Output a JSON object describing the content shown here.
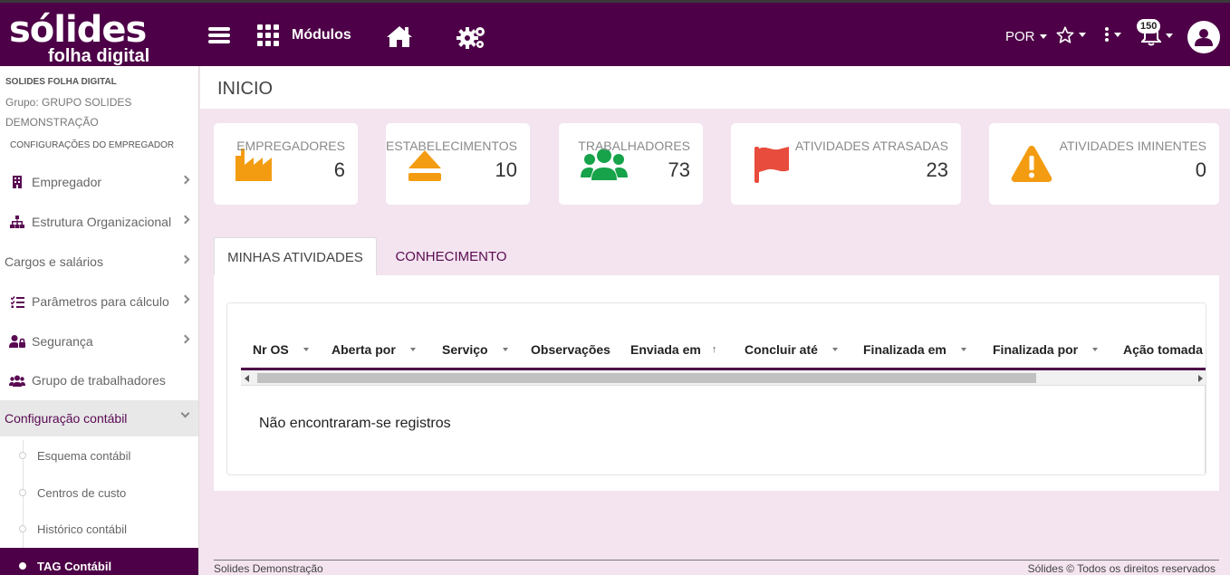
{
  "topbar": {
    "logo_line1": "sólides",
    "logo_line2": "folha digital",
    "modules_label": "Módulos",
    "language": "POR",
    "notifications_count": "150"
  },
  "sidebar": {
    "company": "SOLIDES FOLHA DIGITAL",
    "group": "Grupo: GRUPO SOLIDES DEMONSTRAÇÃO",
    "section": "CONFIGURAÇÕES DO EMPREGADOR",
    "items": [
      {
        "label": "Empregador",
        "icon": "building-icon"
      },
      {
        "label": "Estrutura Organizacional",
        "icon": "sitemap-icon"
      },
      {
        "label": "Cargos e salários",
        "icon": ""
      },
      {
        "label": "Parâmetros para cálculo",
        "icon": "list-check-icon"
      },
      {
        "label": "Segurança",
        "icon": "user-lock-icon"
      },
      {
        "label": "Grupo de trabalhadores",
        "icon": "users-icon"
      },
      {
        "label": "Configuração contábil",
        "icon": ""
      }
    ],
    "subitems": [
      {
        "label": "Esquema contábil"
      },
      {
        "label": "Centros de custo"
      },
      {
        "label": "Histórico contábil"
      },
      {
        "label": "TAG Contábil"
      }
    ]
  },
  "page": {
    "title": "INICIO"
  },
  "cards": [
    {
      "label": "EMPREGADORES",
      "value": "6",
      "icon": "factory-icon",
      "color": "#f39c12"
    },
    {
      "label": "ESTABELECIMENTOS",
      "value": "10",
      "icon": "eject-icon",
      "color": "#f39c12"
    },
    {
      "label": "TRABALHADORES",
      "value": "73",
      "icon": "users-icon",
      "color": "#16a34a"
    },
    {
      "label": "ATIVIDADES ATRASADAS",
      "value": "23",
      "icon": "flag-icon",
      "color": "#e74c3c"
    },
    {
      "label": "ATIVIDADES IMINENTES",
      "value": "0",
      "icon": "warning-icon",
      "color": "#f39c12"
    }
  ],
  "tabs": [
    {
      "label": "MINHAS ATIVIDADES"
    },
    {
      "label": "CONHECIMENTO"
    }
  ],
  "table": {
    "columns": [
      "Nr OS",
      "Aberta por",
      "Serviço",
      "Observações",
      "Enviada em",
      "Concluir até",
      "Finalizada em",
      "Finalizada por",
      "Ação tomada"
    ],
    "empty_message": "Não encontraram-se registros"
  },
  "footer": {
    "left": "Solides Demonstração",
    "right": "Sólides © Todos os direitos reservados"
  }
}
